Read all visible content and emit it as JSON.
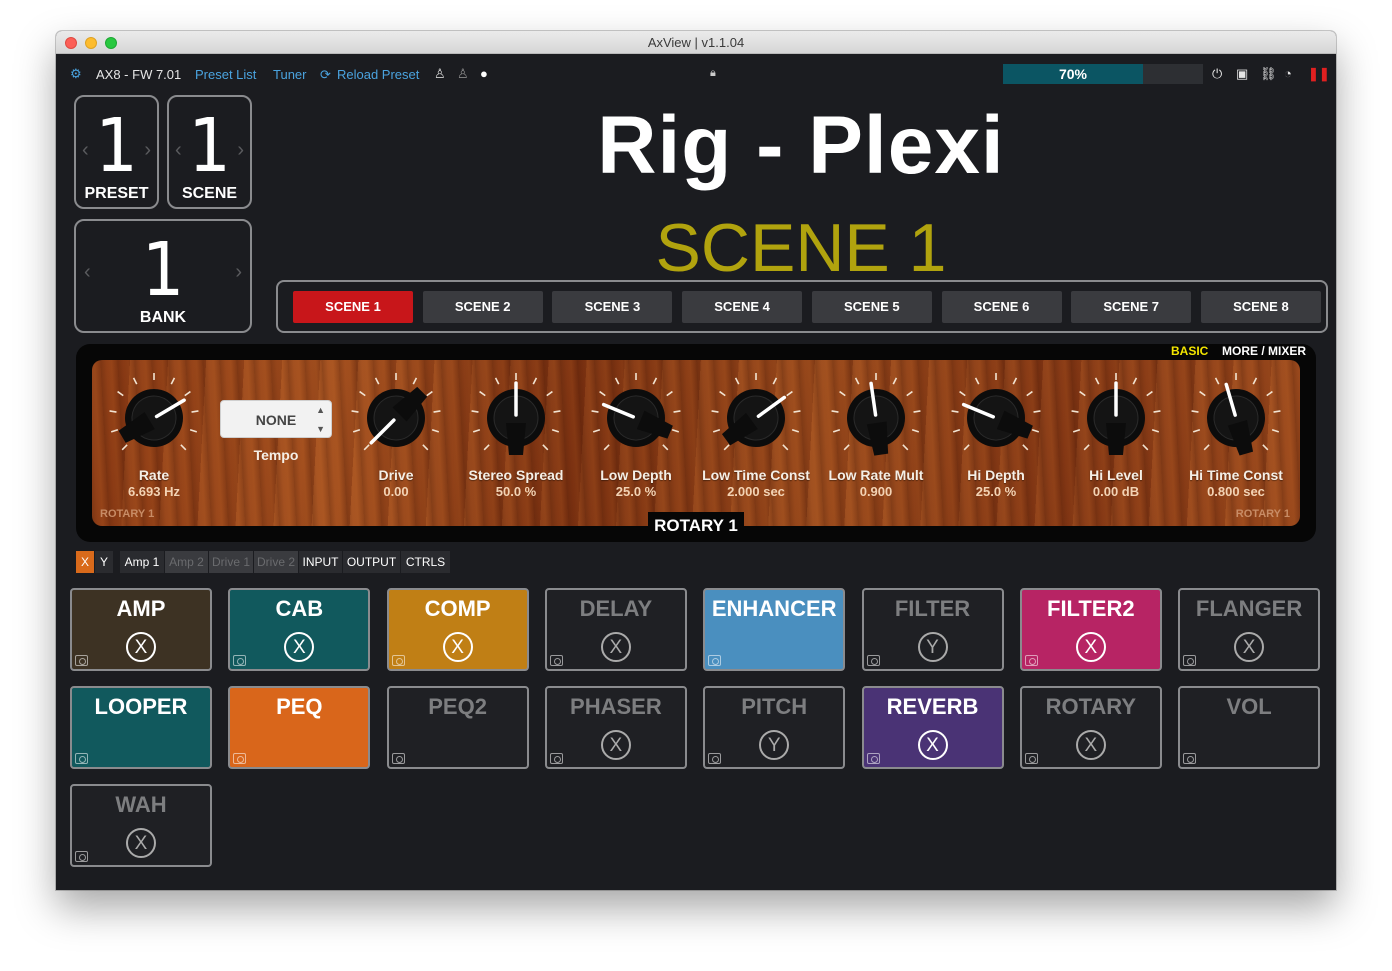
{
  "window": {
    "title": "AxView | v1.1.04"
  },
  "toolbar": {
    "device": "AX8 - FW 7.01",
    "preset_list": "Preset List",
    "tuner": "Tuner",
    "reload": "Reload Preset",
    "cpu_label": "70%",
    "cpu_percent": 70
  },
  "counters": {
    "preset": {
      "value": "1",
      "label": "PRESET"
    },
    "scene": {
      "value": "1",
      "label": "SCENE"
    },
    "bank": {
      "value": "1",
      "label": "BANK"
    }
  },
  "rig": {
    "title": "Rig - Plexi",
    "scene_title": "SCENE 1"
  },
  "scenes": [
    "SCENE 1",
    "SCENE 2",
    "SCENE 3",
    "SCENE 4",
    "SCENE 5",
    "SCENE 6",
    "SCENE 7",
    "SCENE 8"
  ],
  "active_scene_index": 0,
  "panel": {
    "mode_basic": "BASIC",
    "mode_more": "MORE / MIXER",
    "name": "ROTARY 1",
    "corner_left": "ROTARY 1",
    "corner_right": "ROTARY 1",
    "tempo_value": "NONE",
    "tempo_label": "Tempo",
    "knobs": [
      {
        "label": "Rate",
        "value": "6.693 Hz",
        "level": 0.72
      },
      {
        "label": "Drive",
        "value": "0.00",
        "level": 0.0
      },
      {
        "label": "Stereo Spread",
        "value": "50.0 %",
        "level": 0.5
      },
      {
        "label": "Low Depth",
        "value": "25.0 %",
        "level": 0.25
      },
      {
        "label": "Low Time Const",
        "value": "2.000 sec",
        "level": 0.7
      },
      {
        "label": "Low Rate Mult",
        "value": "0.900",
        "level": 0.47
      },
      {
        "label": "Hi Depth",
        "value": "25.0 %",
        "level": 0.25
      },
      {
        "label": "Hi Level",
        "value": "0.00 dB",
        "level": 0.5
      },
      {
        "label": "Hi Time Const",
        "value": "0.800 sec",
        "level": 0.44
      }
    ]
  },
  "xy": {
    "x": "X",
    "y": "Y",
    "tabs": [
      "Amp 1",
      "Amp 2",
      "Drive 1",
      "Drive 2",
      "INPUT",
      "OUTPUT",
      "CTRLS"
    ]
  },
  "blocks": [
    {
      "name": "AMP",
      "state": "X",
      "color": "#3d3223",
      "text": "#ffffff",
      "off": false
    },
    {
      "name": "CAB",
      "state": "X",
      "color": "#11595d",
      "text": "#ffffff",
      "off": false
    },
    {
      "name": "COMP",
      "state": "X",
      "color": "#c07f15",
      "text": "#ffffff",
      "off": false
    },
    {
      "name": "DELAY",
      "state": "X",
      "color": "#1f2024",
      "text": "#7d7e80",
      "off": true
    },
    {
      "name": "ENHANCER",
      "state": "",
      "color": "#4a8fbf",
      "text": "#ffffff",
      "off": false
    },
    {
      "name": "FILTER",
      "state": "Y",
      "color": "#1f2024",
      "text": "#7d7e80",
      "off": true
    },
    {
      "name": "FILTER2",
      "state": "X",
      "color": "#b72464",
      "text": "#ffffff",
      "off": false
    },
    {
      "name": "FLANGER",
      "state": "X",
      "color": "#1f2024",
      "text": "#7d7e80",
      "off": true
    },
    {
      "name": "LOOPER",
      "state": "",
      "color": "#11595d",
      "text": "#ffffff",
      "off": false
    },
    {
      "name": "PEQ",
      "state": "",
      "color": "#d9661b",
      "text": "#ffffff",
      "off": false
    },
    {
      "name": "PEQ2",
      "state": "",
      "color": "#1f2024",
      "text": "#7d7e80",
      "off": true
    },
    {
      "name": "PHASER",
      "state": "X",
      "color": "#1f2024",
      "text": "#7d7e80",
      "off": true
    },
    {
      "name": "PITCH",
      "state": "Y",
      "color": "#1f2024",
      "text": "#7d7e80",
      "off": true
    },
    {
      "name": "REVERB",
      "state": "X",
      "color": "#4a3375",
      "text": "#ffffff",
      "off": false
    },
    {
      "name": "ROTARY",
      "state": "X",
      "color": "#1f2024",
      "text": "#7d7e80",
      "off": true
    },
    {
      "name": "VOL",
      "state": "",
      "color": "#1f2024",
      "text": "#7d7e80",
      "off": true
    },
    {
      "name": "WAH",
      "state": "X",
      "color": "#1f2024",
      "text": "#7d7e80",
      "off": true
    }
  ]
}
